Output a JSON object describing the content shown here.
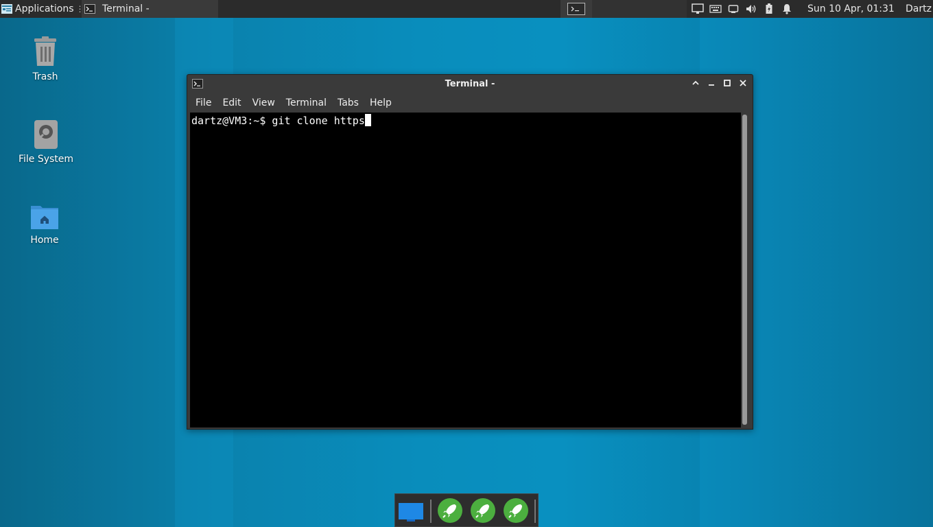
{
  "top_panel": {
    "applications_label": "Applications",
    "task_label": "Terminal -",
    "clock": "Sun 10 Apr, 01:31",
    "user": "Dartz"
  },
  "desktop": {
    "icons": [
      {
        "label": "Trash",
        "icon": "trash-icon"
      },
      {
        "label": "File System",
        "icon": "drive-icon"
      },
      {
        "label": "Home",
        "icon": "home-folder-icon"
      }
    ]
  },
  "terminal_window": {
    "title": "Terminal -",
    "menu": [
      "File",
      "Edit",
      "View",
      "Terminal",
      "Tabs",
      "Help"
    ],
    "prompt": "dartz@VM3:~$ ",
    "command": "git clone https"
  },
  "dock": {
    "items": [
      "show-desktop-icon",
      "launcher-icon",
      "launcher-icon",
      "launcher-icon"
    ]
  },
  "colors": {
    "desktop_bg": "#0a93c4",
    "panel_bg": "#2b2b2b",
    "terminal_bg": "#000000",
    "launcher_green": "#4caf3f"
  }
}
